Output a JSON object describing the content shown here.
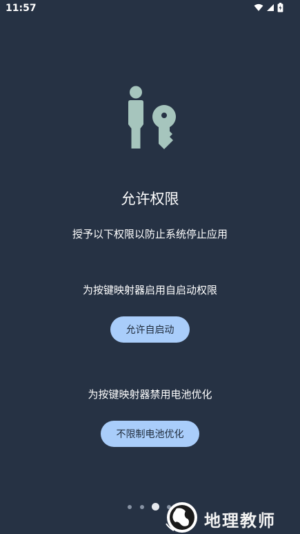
{
  "status_bar": {
    "time": "11:57",
    "icons": [
      "wifi-icon",
      "signal-icon",
      "battery-icon"
    ]
  },
  "hero": {
    "icon": "person-key-icon",
    "color": "#a6c5bd"
  },
  "page": {
    "title": "允许权限",
    "subtitle": "授予以下权限以防止系统停止应用"
  },
  "autostart": {
    "label": "为按键映射器启用自启动权限",
    "button": "允许自启动"
  },
  "battery": {
    "label": "为按键映射器禁用电池优化",
    "button": "不限制电池优化"
  },
  "pager": {
    "count": 4,
    "active_index": 2
  },
  "watermark": {
    "text": "地理教师"
  },
  "colors": {
    "background": "#263244",
    "button": "#a9cdfa",
    "button_text": "#1e2a3a"
  }
}
